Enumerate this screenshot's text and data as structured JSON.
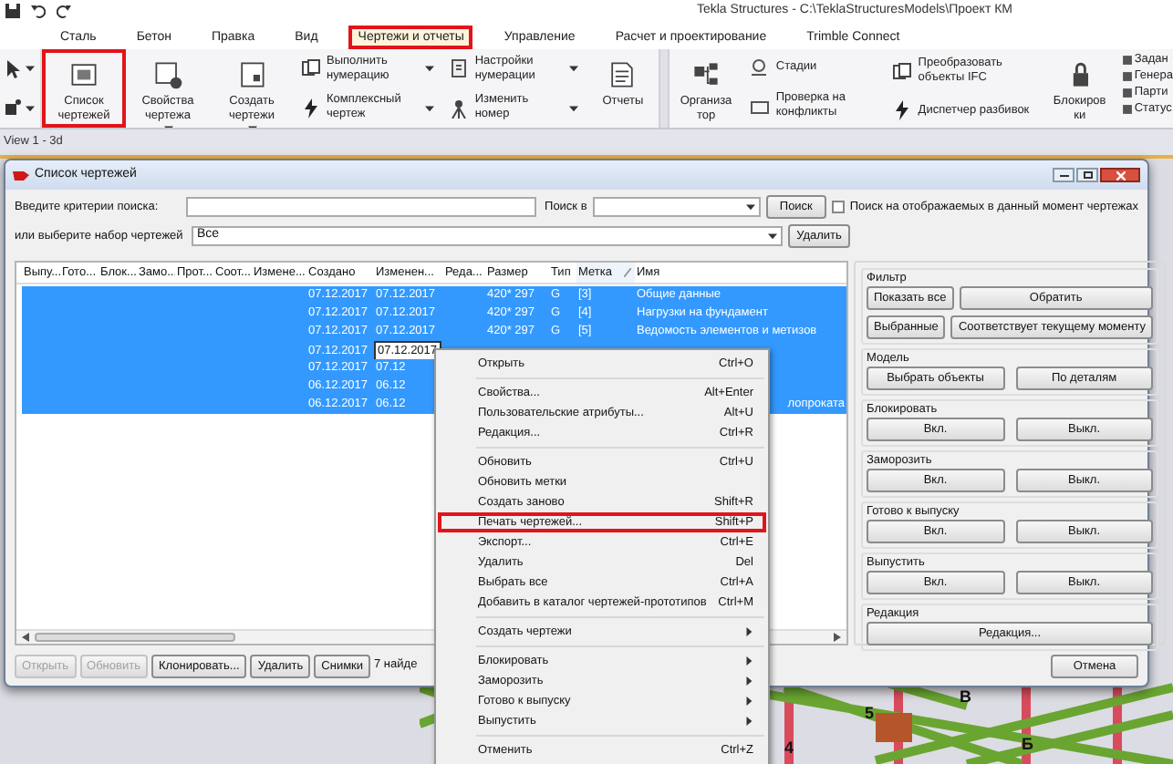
{
  "window": {
    "title": "Tekla Structures - C:\\TeklaStructuresModels\\Проект КМ"
  },
  "tabs": [
    {
      "label": "Сталь",
      "selected": false,
      "highlighted": false
    },
    {
      "label": "Бетон",
      "selected": false,
      "highlighted": false
    },
    {
      "label": "Правка",
      "selected": false,
      "highlighted": false
    },
    {
      "label": "Вид",
      "selected": false,
      "highlighted": false
    },
    {
      "label": "Чертежи и отчеты",
      "selected": true,
      "highlighted": true
    },
    {
      "label": "Управление",
      "selected": false,
      "highlighted": false
    },
    {
      "label": "Расчет и проектирование",
      "selected": false,
      "highlighted": false
    },
    {
      "label": "Trimble Connect",
      "selected": false,
      "highlighted": false
    }
  ],
  "ribbon": [
    {
      "kind": "large",
      "label": "Список чертежей",
      "highlighted": true,
      "dropdown": false
    },
    {
      "kind": "large",
      "label": "Свойства чертежа",
      "highlighted": false,
      "dropdown": true
    },
    {
      "kind": "large",
      "label": "Создать чертежи",
      "highlighted": false,
      "dropdown": true
    },
    {
      "kind": "stack",
      "items": [
        {
          "label": "Выполнить нумерацию",
          "dropdown": true
        },
        {
          "label": "Комплексный чертеж",
          "dropdown": true
        }
      ]
    },
    {
      "kind": "stack",
      "items": [
        {
          "label": "Настройки нумерации",
          "dropdown": true
        },
        {
          "label": "Изменить номер",
          "dropdown": true
        }
      ]
    },
    {
      "kind": "large",
      "label": "Отчеты",
      "highlighted": false,
      "dropdown": false
    },
    {
      "kind": "separator"
    },
    {
      "kind": "large",
      "label": "Организатор",
      "highlighted": false,
      "dropdown": false
    },
    {
      "kind": "stack",
      "items": [
        {
          "label": "Стадии",
          "dropdown": false
        },
        {
          "label": "Проверка на конфликты",
          "dropdown": false
        }
      ]
    },
    {
      "kind": "stack",
      "items": [
        {
          "label": "Преобразовать объекты IFC",
          "dropdown": false
        },
        {
          "label": "Диспетчер разбивок",
          "dropdown": false
        }
      ]
    },
    {
      "kind": "large",
      "label": "Блокировки",
      "highlighted": false,
      "dropdown": false
    },
    {
      "kind": "mini",
      "items": [
        {
          "label": "Задан"
        },
        {
          "label": "Генера"
        },
        {
          "label": "Парти"
        },
        {
          "label": "Статус"
        }
      ]
    }
  ],
  "view_title": "View 1 - 3d",
  "dialog": {
    "title": "Список чертежей",
    "search_label": "Введите критерии поиска:",
    "search_in_label": "Поиск в",
    "search_button": "Поиск",
    "visible_only": {
      "label": "Поиск на отображаемых в данный момент чертежах",
      "checked": false
    },
    "set_label": "или выберите набор чертежей",
    "set_value": "Все",
    "delete_set_button": "Удалить",
    "columns": [
      {
        "label": "Выпу...",
        "sorted": false
      },
      {
        "label": "Гото...",
        "sorted": false
      },
      {
        "label": "Блок...",
        "sorted": false
      },
      {
        "label": "Замо...",
        "sorted": false
      },
      {
        "label": "Прот...",
        "sorted": false
      },
      {
        "label": "Соот...",
        "sorted": false
      },
      {
        "label": "Измене...",
        "sorted": false
      },
      {
        "label": "Создано",
        "sorted": false
      },
      {
        "label": "Изменен...",
        "sorted": false
      },
      {
        "label": "Реда...",
        "sorted": false
      },
      {
        "label": "Размер",
        "sorted": false
      },
      {
        "label": "Тип",
        "sorted": false
      },
      {
        "label": "Метка",
        "sorted": true
      },
      {
        "label": "Имя",
        "sorted": false
      }
    ],
    "rows": [
      {
        "selected": true,
        "created": "07.12.2017",
        "modified": "07.12.2017",
        "focused": false,
        "size": "420* 297",
        "type": "G",
        "mark": "[3]",
        "name": "Общие данные",
        "name_cut": false
      },
      {
        "selected": true,
        "created": "07.12.2017",
        "modified": "07.12.2017",
        "focused": false,
        "size": "420* 297",
        "type": "G",
        "mark": "[4]",
        "name": "Нагрузки на фундамент",
        "name_cut": false
      },
      {
        "selected": true,
        "created": "07.12.2017",
        "modified": "07.12.2017",
        "focused": false,
        "size": "420* 297",
        "type": "G",
        "mark": "[5]",
        "name": "Ведомость элементов и метизов",
        "name_cut": false
      },
      {
        "selected": true,
        "created": "07.12.2017",
        "modified": "07.12.2017",
        "focused": true
      },
      {
        "selected": true,
        "created": "07.12.2017",
        "modified": "07.12",
        "focused": false
      },
      {
        "selected": true,
        "created": "06.12.2017",
        "modified": "06.12",
        "focused": false
      },
      {
        "selected": true,
        "created": "06.12.2017",
        "modified": "06.12",
        "focused": false,
        "name": "лопроката",
        "name_cut": true
      }
    ],
    "groups": [
      {
        "title": "Фильтр",
        "kind": "filter",
        "buttons": [
          "Показать все",
          "Обратить",
          "Выбранные",
          "Соответствует текущему моменту"
        ]
      },
      {
        "title": "Модель",
        "kind": "pair",
        "buttons": [
          "Выбрать объекты",
          "По деталям"
        ]
      },
      {
        "title": "Блокировать",
        "kind": "pair",
        "buttons": [
          "Вкл.",
          "Выкл."
        ]
      },
      {
        "title": "Заморозить",
        "kind": "pair",
        "buttons": [
          "Вкл.",
          "Выкл."
        ]
      },
      {
        "title": "Готово к выпуску",
        "kind": "pair",
        "buttons": [
          "Вкл.",
          "Выкл."
        ]
      },
      {
        "title": "Выпустить",
        "kind": "pair",
        "buttons": [
          "Вкл.",
          "Выкл."
        ]
      },
      {
        "title": "Редакция",
        "kind": "single",
        "buttons": [
          "Редакция..."
        ]
      }
    ],
    "bottom_buttons": [
      {
        "label": "Открыть",
        "disabled": true
      },
      {
        "label": "Обновить",
        "disabled": true
      },
      {
        "label": "Клонировать...",
        "disabled": false
      },
      {
        "label": "Удалить",
        "disabled": false
      },
      {
        "label": "Снимки",
        "disabled": false
      }
    ],
    "found_text": "7 найде",
    "cancel_button": "Отмена"
  },
  "context_menu": [
    {
      "kind": "item",
      "label": "Открыть",
      "shortcut": "Ctrl+O",
      "highlighted": false
    },
    {
      "kind": "separator"
    },
    {
      "kind": "item",
      "label": "Свойства...",
      "shortcut": "Alt+Enter",
      "highlighted": false
    },
    {
      "kind": "item",
      "label": "Пользовательские атрибуты...",
      "shortcut": "Alt+U",
      "highlighted": false
    },
    {
      "kind": "item",
      "label": "Редакция...",
      "shortcut": "Ctrl+R",
      "highlighted": false
    },
    {
      "kind": "separator"
    },
    {
      "kind": "item",
      "label": "Обновить",
      "shortcut": "Ctrl+U",
      "highlighted": false
    },
    {
      "kind": "item",
      "label": "Обновить метки",
      "highlighted": false
    },
    {
      "kind": "item",
      "label": "Создать заново",
      "shortcut": "Shift+R",
      "highlighted": false
    },
    {
      "kind": "item",
      "label": "Печать чертежей...",
      "shortcut": "Shift+P",
      "highlighted": true
    },
    {
      "kind": "item",
      "label": "Экспорт...",
      "shortcut": "Ctrl+E",
      "highlighted": false
    },
    {
      "kind": "item",
      "label": "Удалить",
      "shortcut": "Del",
      "highlighted": false
    },
    {
      "kind": "item",
      "label": "Выбрать все",
      "shortcut": "Ctrl+A",
      "highlighted": false
    },
    {
      "kind": "item",
      "label": "Добавить в каталог чертежей-прототипов",
      "shortcut": "Ctrl+M",
      "highlighted": false
    },
    {
      "kind": "separator"
    },
    {
      "kind": "submenu",
      "label": "Создать чертежи"
    },
    {
      "kind": "separator"
    },
    {
      "kind": "submenu",
      "label": "Блокировать"
    },
    {
      "kind": "submenu",
      "label": "Заморозить"
    },
    {
      "kind": "submenu",
      "label": "Готово к выпуску"
    },
    {
      "kind": "submenu",
      "label": "Выпустить"
    },
    {
      "kind": "separator"
    },
    {
      "kind": "item",
      "label": "Отменить",
      "shortcut": "Ctrl+Z",
      "highlighted": false
    }
  ],
  "viewport": {
    "axis_labels": [
      "4",
      "5",
      "В",
      "Б"
    ]
  }
}
